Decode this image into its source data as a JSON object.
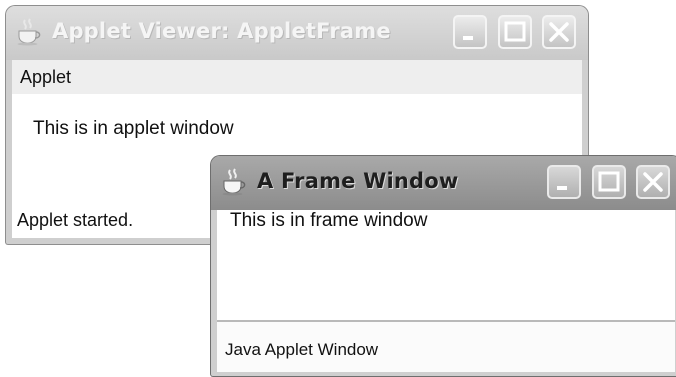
{
  "applet_viewer": {
    "title": "Applet Viewer: AppletFrame",
    "menu": "Applet",
    "message": "This is in applet window",
    "status": "Applet started."
  },
  "frame_window": {
    "title": "A Frame Window",
    "message": "This is in frame window",
    "warning": "Java Applet Window"
  },
  "icons": {
    "app": "java-coffee-cup-icon",
    "minimize": "minimize-icon",
    "maximize": "maximize-icon",
    "close": "close-icon"
  }
}
